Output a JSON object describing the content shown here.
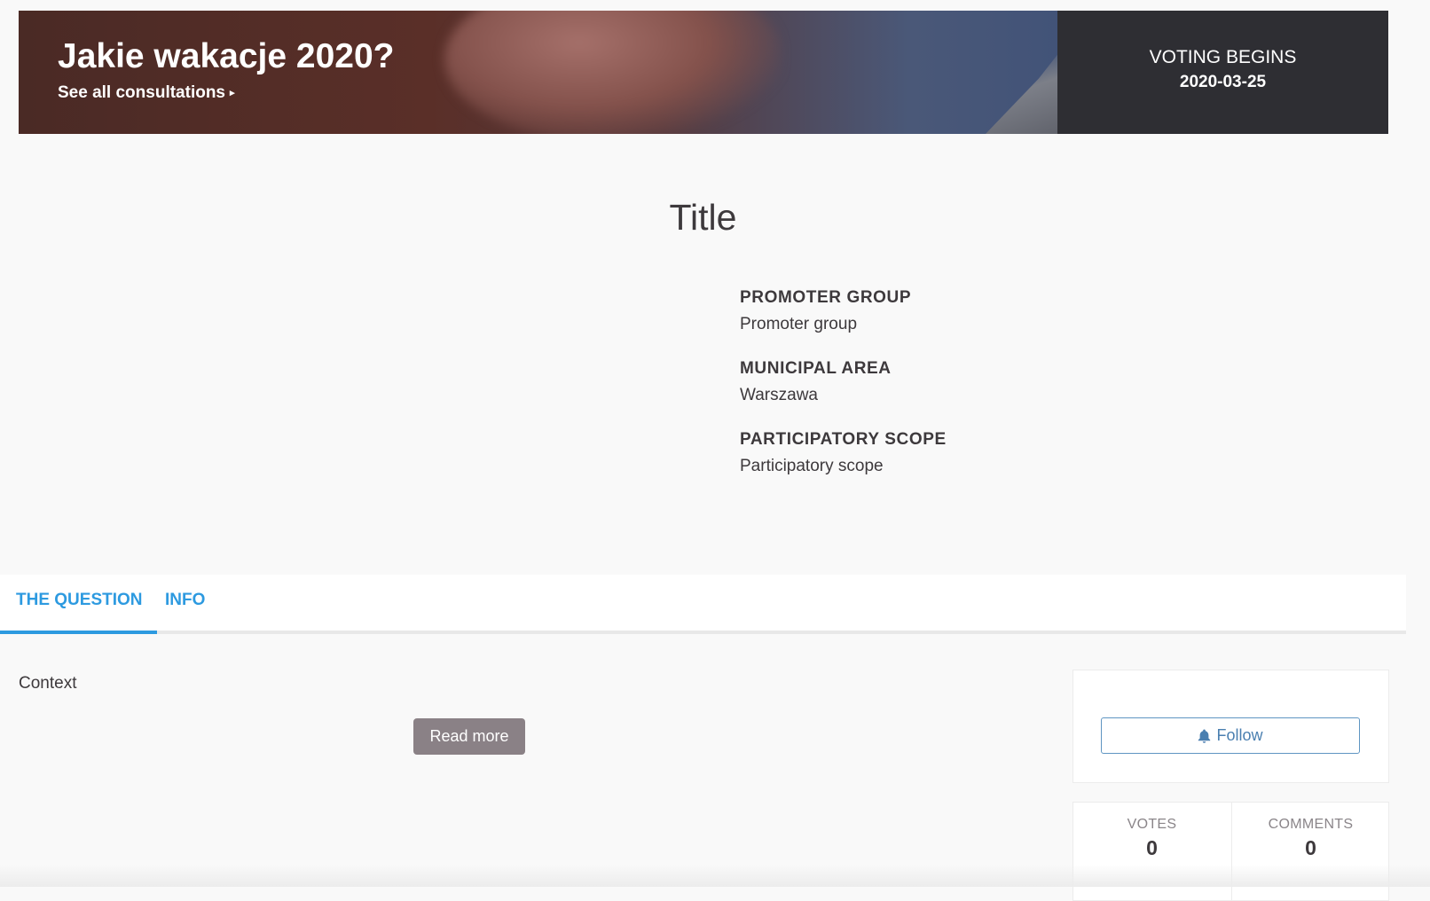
{
  "hero": {
    "title": "Jakie wakacje 2020?",
    "see_all_link": "See all consultations",
    "arrow": "▸",
    "voting_label": "VOTING BEGINS",
    "voting_date": "2020-03-25"
  },
  "page": {
    "title": "Title"
  },
  "meta": [
    {
      "label": "PROMOTER GROUP",
      "value": "Promoter group"
    },
    {
      "label": "MUNICIPAL AREA",
      "value": "Warszawa"
    },
    {
      "label": "PARTICIPATORY SCOPE",
      "value": "Participatory scope"
    }
  ],
  "tabs": [
    {
      "label": "THE QUESTION",
      "active": true
    },
    {
      "label": "INFO",
      "active": false
    }
  ],
  "content": {
    "context": "Context",
    "read_more": "Read more"
  },
  "sidebar": {
    "follow_label": "Follow",
    "follow_icon": "bell-icon",
    "stats": [
      {
        "label": "VOTES",
        "value": "0"
      },
      {
        "label": "COMMENTS",
        "value": "0"
      }
    ]
  },
  "colors": {
    "accent_blue": "#2d9ae0",
    "voting_panel": "#2e2e33",
    "read_more_bg": "#8a8186",
    "follow_border": "#5f95c2"
  }
}
